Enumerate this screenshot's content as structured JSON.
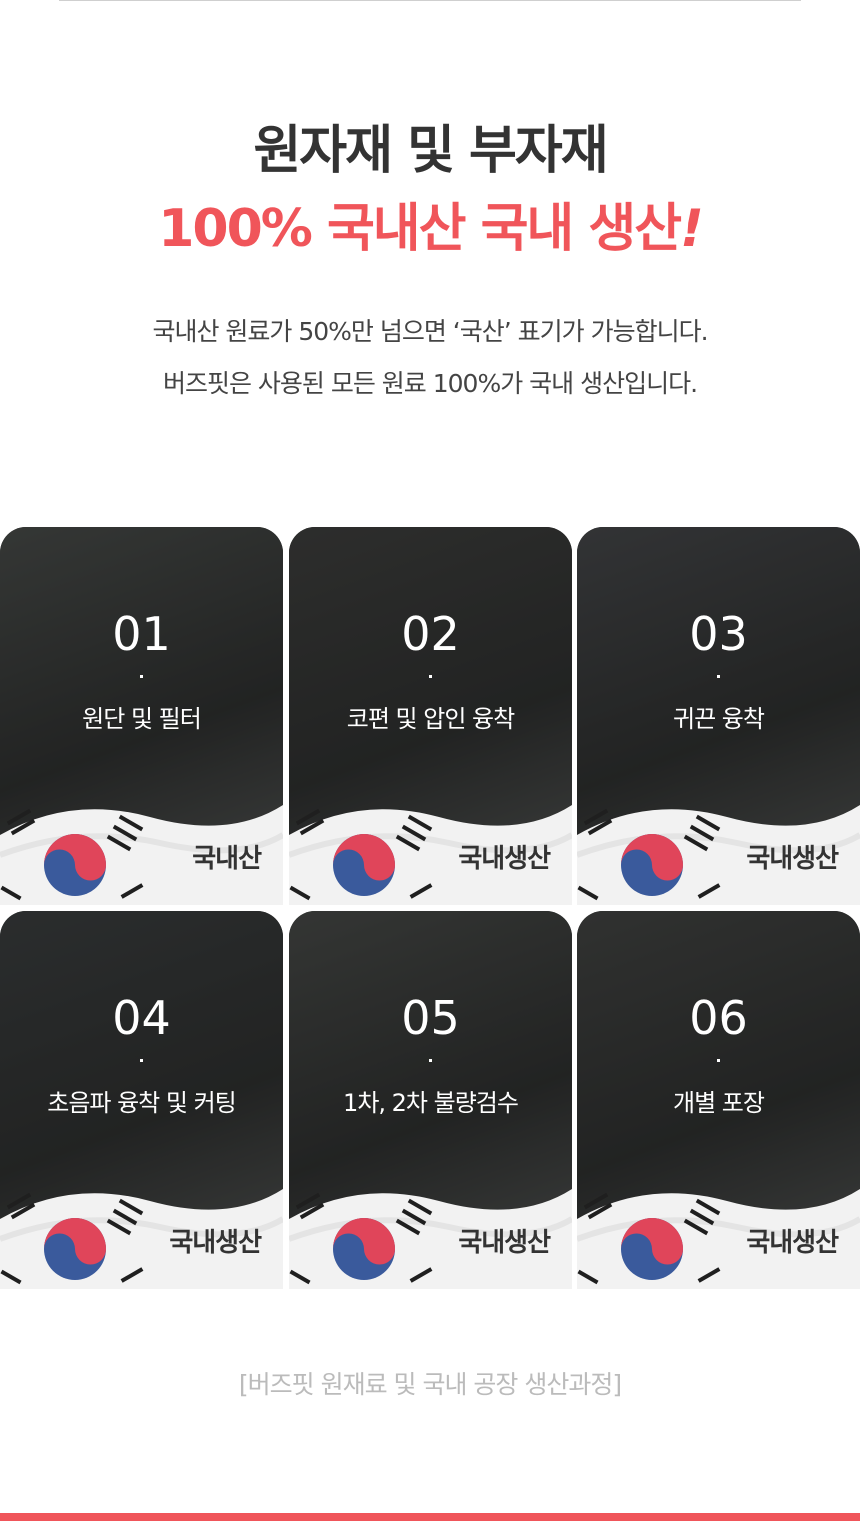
{
  "headline": {
    "line1": "원자재 및 부자재",
    "line2_text": "100% 국내산 국내 생산",
    "line2_mark": "!",
    "line1_color": "#333333",
    "line2_color": "#f0555a"
  },
  "description": {
    "line1": "국내산 원료가 50%만 넘으면 ‘국산’ 표기가 가능합니다.",
    "line2": "버즈핏은 사용된 모든 원료 100%가 국내 생산입니다."
  },
  "steps": [
    {
      "number": "01",
      "title": "원단 및 필터",
      "badge": "국내산",
      "photo_tone": "#5b5f5c"
    },
    {
      "number": "02",
      "title": "코편 및 압인 융착",
      "badge": "국내생산",
      "photo_tone": "#4e4f4d"
    },
    {
      "number": "03",
      "title": "귀끈 융착",
      "badge": "국내생산",
      "photo_tone": "#57595c"
    },
    {
      "number": "04",
      "title": "초음파 융착 및 커팅",
      "badge": "국내생산",
      "photo_tone": "#4a4e4f"
    },
    {
      "number": "05",
      "title": "1차, 2차 불량검수",
      "badge": "국내생산",
      "photo_tone": "#5a5d5a"
    },
    {
      "number": "06",
      "title": "개별 포장",
      "badge": "국내생산",
      "photo_tone": "#545654"
    }
  ],
  "caption": "[버즈핏 원재료 및 국내 공장 생산과정]",
  "colors": {
    "accent": "#f0555a",
    "flag_red": "#e0455a",
    "flag_blue": "#3a5a9c"
  }
}
